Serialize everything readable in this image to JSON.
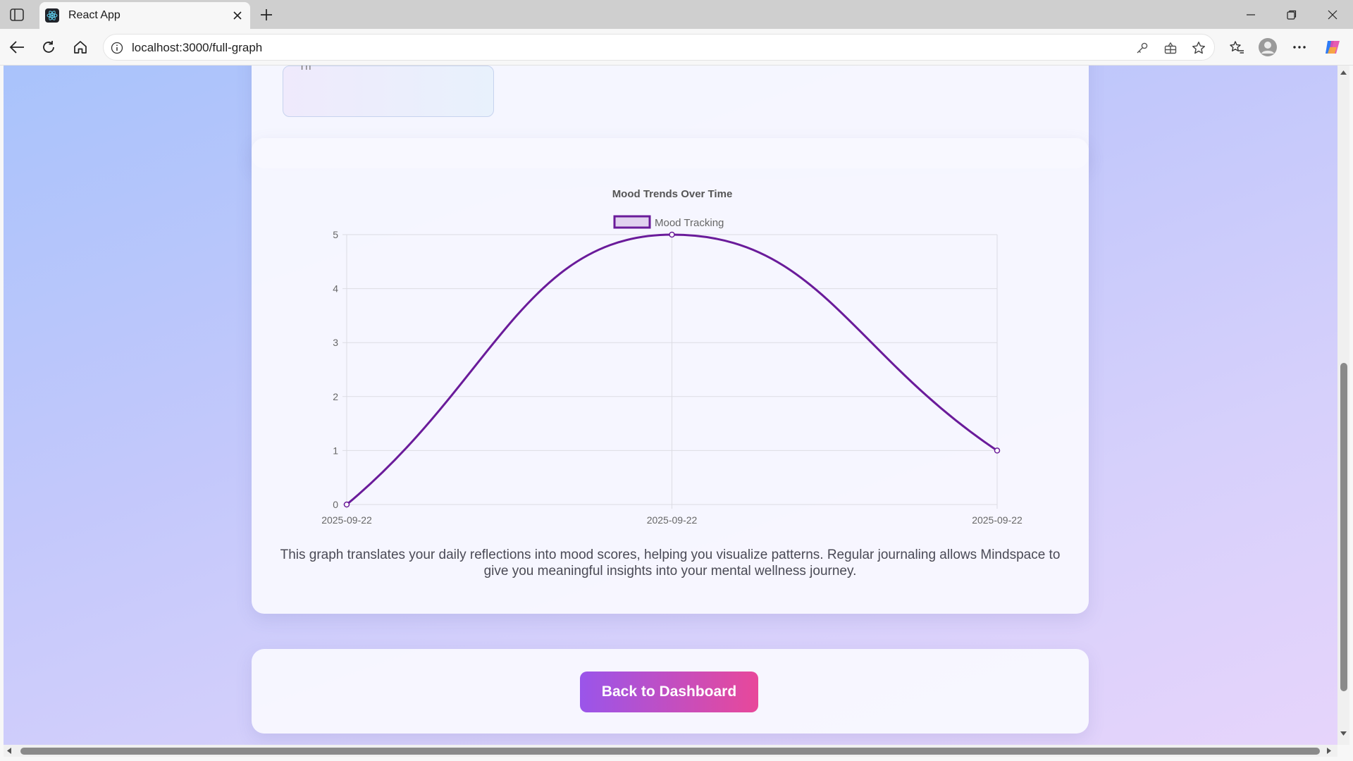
{
  "browser": {
    "tab_title": "React App",
    "url": "localhost:3000/full-graph",
    "icons": [
      "sidebar-icon",
      "react-logo-icon",
      "close-icon",
      "plus-icon",
      "back-icon",
      "refresh-icon",
      "home-icon",
      "info-icon",
      "key-icon",
      "apps-icon",
      "star-icon",
      "favorites-icon",
      "profile-icon",
      "more-icon",
      "copilot-icon",
      "minimize-icon",
      "restore-icon",
      "close-window-icon"
    ]
  },
  "page": {
    "prev_card_text": "Th",
    "caption": "This graph translates your daily reflections into mood scores, helping you visualize patterns. Regular journaling allows Mindspace to give you meaningful insights into your mental wellness journey.",
    "back_button": "Back to Dashboard"
  },
  "colors": {
    "line": "#6a1b9a",
    "legend_fill": "#e1d1ef",
    "button_start": "#9a55ea",
    "button_end": "#e8489a"
  },
  "chart_data": {
    "type": "line",
    "title": "Mood Trends Over Time",
    "legend_position": "top-center",
    "series": [
      {
        "name": "Mood Tracking",
        "x": [
          "2025-09-22",
          "2025-09-22",
          "2025-09-22"
        ],
        "values": [
          0,
          5,
          1
        ]
      }
    ],
    "ylim": [
      0,
      5
    ],
    "yticks": [
      "0",
      "1",
      "2",
      "3",
      "4",
      "5"
    ],
    "xticks": [
      "2025-09-22",
      "2025-09-22",
      "2025-09-22"
    ],
    "grid": true,
    "smooth": true
  }
}
